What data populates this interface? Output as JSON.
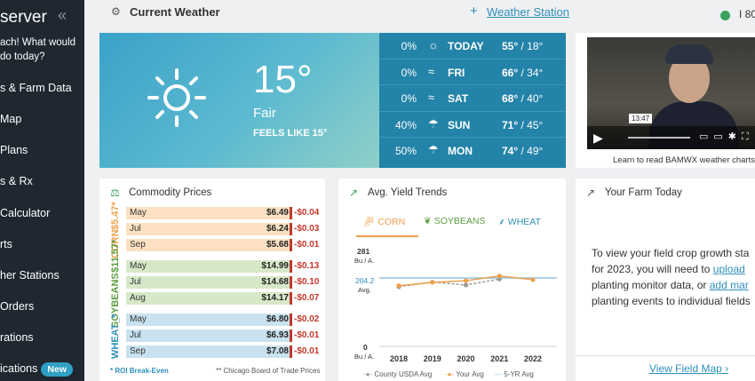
{
  "sidebar": {
    "brand": "server",
    "collapse_icon": "double-chevron-left-icon",
    "question_line1": "ach! What would",
    "question_line2": "do today?",
    "items": [
      {
        "label": "s & Farm Data"
      },
      {
        "label": "Map"
      },
      {
        "label": "Plans"
      },
      {
        "label": "s & Rx"
      },
      {
        "label": "Calculator"
      },
      {
        "label": "rts"
      },
      {
        "label": "her Stations"
      },
      {
        "label": "Orders"
      },
      {
        "label": "rations"
      },
      {
        "label": "ications",
        "badge": "New"
      }
    ]
  },
  "header": {
    "title": "Current Weather",
    "add_station_label": "Weather Station",
    "user_label": "I 80"
  },
  "weather": {
    "current": {
      "temp": "15°",
      "condition": "Fair",
      "feels_like": "FEELS LIKE 15°"
    },
    "forecast": [
      {
        "precip": "0%",
        "icon": "sun-icon",
        "day": "TODAY",
        "high": "55°",
        "low": " / 18°"
      },
      {
        "precip": "0%",
        "icon": "wind-icon",
        "day": "FRI",
        "high": "66°",
        "low": " / 34°"
      },
      {
        "precip": "0%",
        "icon": "wind-icon",
        "day": "SAT",
        "high": "68°",
        "low": " / 40°"
      },
      {
        "precip": "40%",
        "icon": "storm-icon",
        "day": "SUN",
        "high": "71°",
        "low": " / 45°"
      },
      {
        "precip": "50%",
        "icon": "storm-icon",
        "day": "MON",
        "high": "74°",
        "low": " / 49°"
      }
    ]
  },
  "video": {
    "timestamp": "13:47",
    "caption": "Learn to read BAMWX weather charts ",
    "caption_link": "h"
  },
  "commodity": {
    "title": "Commodity Prices",
    "crops": [
      {
        "name": "CORN",
        "breakeven": "$5.47*",
        "color": "#f0a04b",
        "row_color": "#fbe0c2",
        "rows": [
          {
            "month": "May",
            "price": "$6.49",
            "change": "-$0.04"
          },
          {
            "month": "Jul",
            "price": "$6.24",
            "change": "-$0.03"
          },
          {
            "month": "Sep",
            "price": "$5.68",
            "change": "-$0.01"
          }
        ]
      },
      {
        "name": "SOYBEANS",
        "breakeven": "$11.57*",
        "color": "#5c9e3f",
        "row_color": "#d6e8c8",
        "rows": [
          {
            "month": "May",
            "price": "$14.99",
            "change": "-$0.13"
          },
          {
            "month": "Jul",
            "price": "$14.68",
            "change": "-$0.10"
          },
          {
            "month": "Aug",
            "price": "$14.17",
            "change": "-$0.07"
          }
        ]
      },
      {
        "name": "WHEAT",
        "breakeven": "_*",
        "color": "#2f8fba",
        "row_color": "#c8e2ef",
        "rows": [
          {
            "month": "May",
            "price": "$6.80",
            "change": "-$0.02"
          },
          {
            "month": "Jul",
            "price": "$6.93",
            "change": "-$0.01"
          },
          {
            "month": "Sep",
            "price": "$7.08",
            "change": "-$0.01"
          }
        ]
      }
    ],
    "footnote_left": "* ROI Break-Even",
    "footnote_right": "** Chicago Board of Trade Prices"
  },
  "yield": {
    "title": "Avg. Yield Trends",
    "tabs": [
      "CORN",
      "SOYBEANS",
      "WHEAT"
    ],
    "active_tab": "CORN",
    "colors": {
      "county": "#9a9a9a",
      "your": "#f0a04b",
      "five_yr": "#8fc6dd"
    },
    "y_top": "281",
    "y_top_unit": "Bu / A.",
    "y_avg": "204.2",
    "y_avg_unit": "Avg.",
    "y_bottom": "0",
    "y_bottom_unit": "Bu / A.",
    "legend": [
      "County USDA Avg",
      "Your Avg",
      "5-YR Avg"
    ]
  },
  "chart_data": {
    "type": "line",
    "x": [
      2018,
      2019,
      2020,
      2021,
      2022
    ],
    "series": [
      {
        "name": "County USDA Avg",
        "values": [
          178,
          192,
          183,
          201,
          null
        ]
      },
      {
        "name": "Your Avg",
        "values": [
          181,
          191,
          196,
          210,
          199
        ]
      },
      {
        "name": "5-YR Avg",
        "values": [
          204.2,
          204.2,
          204.2,
          204.2,
          204.2
        ]
      }
    ],
    "ylim": [
      0,
      281
    ],
    "xlabel": "",
    "ylabel": "Bu / A."
  },
  "farm": {
    "title": "Your Farm Today",
    "text_1": "To view your field crop growth sta",
    "text_2": "for 2023, you will need to ",
    "link_upload": "upload",
    "text_3": "planting monitor data, or ",
    "link_add": "add mar",
    "text_4": "planting events to individual fields",
    "map_link": "View Field Map"
  }
}
